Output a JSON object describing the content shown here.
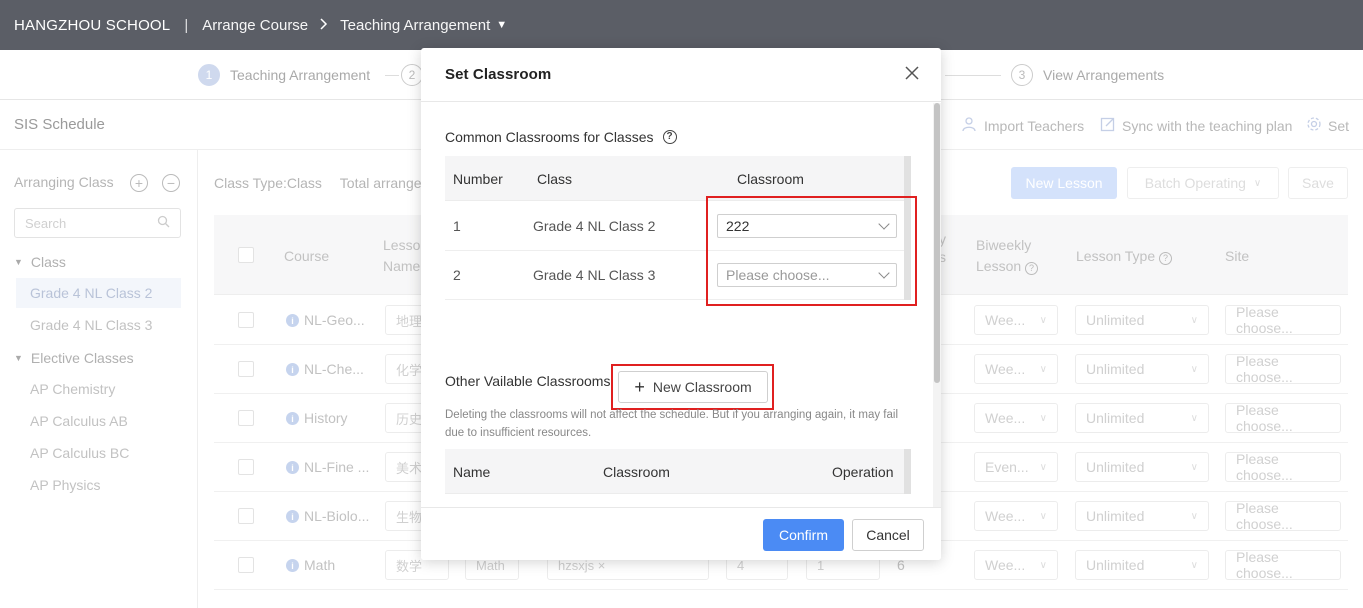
{
  "topbar": {
    "school": "HANGZHOU SCHOOL",
    "separator": "|",
    "crumb1": "Arrange Course",
    "crumb2": "Teaching Arrangement",
    "chevron": ">",
    "caret": "▼"
  },
  "steps": [
    {
      "num": "1",
      "label": "Teaching Arrangement"
    },
    {
      "num": "2",
      "label": ""
    },
    {
      "num": "3",
      "label": "View Arrangements"
    }
  ],
  "page": {
    "title": "SIS Schedule",
    "toolbar": {
      "import_teachers": "Import Teachers",
      "sync": "Sync with the teaching plan",
      "set": "Set",
      "truncated": "t"
    }
  },
  "sidebar": {
    "heading": "Arranging Class",
    "add": "+",
    "remove": "−",
    "search_placeholder": "Search",
    "groups": [
      {
        "label": "Class",
        "items": [
          "Grade 4 NL Class 2",
          "Grade 4 NL Class 3"
        ]
      },
      {
        "label": "Elective Classes",
        "items": [
          "AP Chemistry",
          "AP Calculus AB",
          "AP Calculus BC",
          "AP Physics"
        ]
      }
    ]
  },
  "main": {
    "filter_type": "Class Type:Class",
    "filter_total": "Total arrangeab",
    "new_lesson": "New Lesson",
    "batch_operating": "Batch Operating",
    "save": "Save",
    "headers": {
      "course": "Course",
      "lesson_name_1": "Lesson",
      "lesson_name_2": "Name",
      "biweekly_1": "Biweekly",
      "biweekly_2": "Lesson",
      "lesson_type": "Lesson Type",
      "site": "Site",
      "partial": "y",
      "partial2": "s"
    },
    "rows": [
      {
        "course": "NL-Geo...",
        "lesson": "地理",
        "biweekly": "Wee...",
        "type": "Unlimited",
        "site": "Please choose..."
      },
      {
        "course": "NL-Che...",
        "lesson": "化学",
        "biweekly": "Wee...",
        "type": "Unlimited",
        "site": "Please choose..."
      },
      {
        "course": "History",
        "lesson": "历史",
        "biweekly": "Wee...",
        "type": "Unlimited",
        "site": "Please choose..."
      },
      {
        "course": "NL-Fine ...",
        "lesson": "美术",
        "biweekly": "Even...",
        "type": "Unlimited",
        "site": "Please choose..."
      },
      {
        "course": "NL-Biolo...",
        "lesson": "生物",
        "biweekly": "Wee...",
        "type": "Unlimited",
        "site": "Please choose..."
      },
      {
        "course": "Math",
        "lesson": "数学",
        "lesson_en": "Math",
        "teacher": "hzsxjs ×",
        "n1": "4",
        "n2": "1",
        "n3": "6",
        "biweekly": "Wee...",
        "type": "Unlimited",
        "site": "Please choose..."
      }
    ]
  },
  "modal": {
    "title": "Set Classroom",
    "close": "X",
    "common_title": "Common Classrooms for Classes",
    "help": "?",
    "common_headers": {
      "number": "Number",
      "class": "Class",
      "classroom": "Classroom"
    },
    "common_rows": [
      {
        "number": "1",
        "class": "Grade 4 NL Class 2",
        "classroom": "222"
      },
      {
        "number": "2",
        "class": "Grade 4 NL Class 3",
        "classroom_placeholder": "Please choose..."
      }
    ],
    "other_title": "Other Vailable Classrooms",
    "new_classroom": "New Classroom",
    "plus": "+",
    "note": "Deleting the classrooms will not affect the schedule. But if you arranging again, it may fail due to insufficient resources.",
    "other_headers": {
      "name": "Name",
      "classroom": "Classroom",
      "operation": "Operation"
    },
    "confirm": "Confirm",
    "cancel": "Cancel"
  }
}
